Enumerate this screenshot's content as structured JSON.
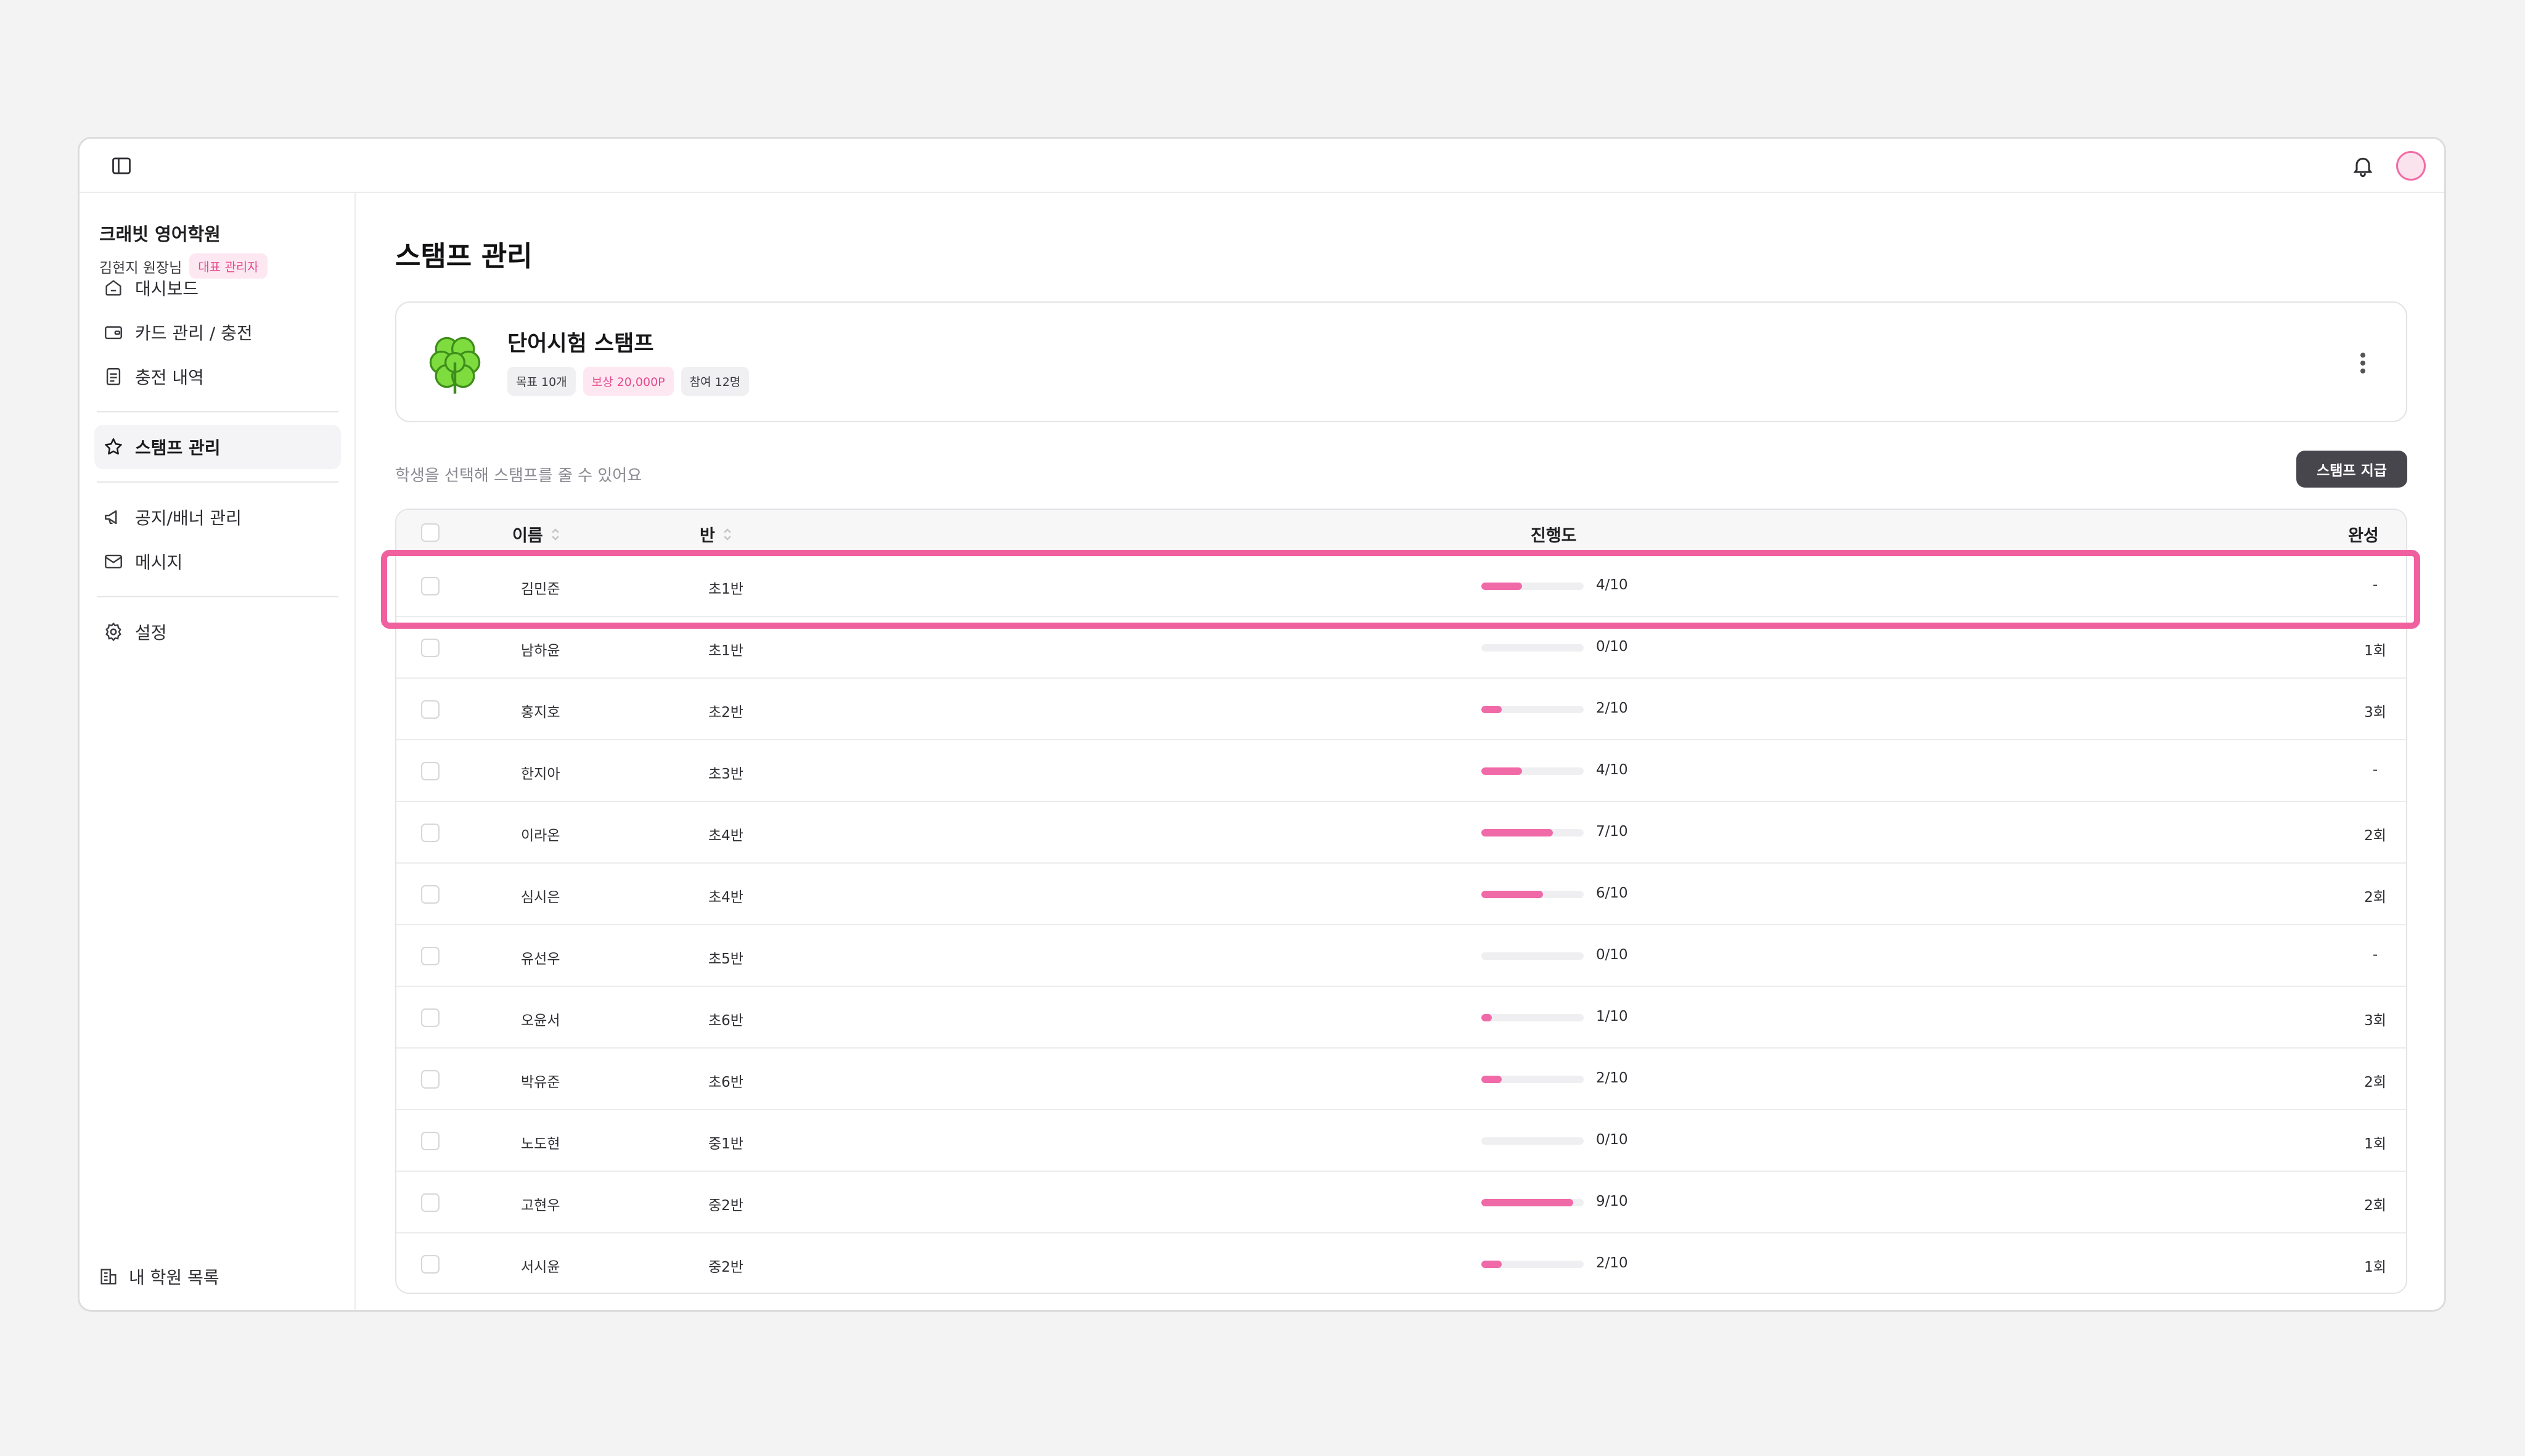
{
  "academy": {
    "name": "크래빗 영어학원",
    "owner": "김현지 원장님",
    "role": "대표 관리자"
  },
  "nav": {
    "group1": [
      {
        "label": "대시보드",
        "icon": "home-icon"
      },
      {
        "label": "카드 관리 / 충전",
        "icon": "wallet-icon"
      },
      {
        "label": "충전 내역",
        "icon": "receipt-icon"
      }
    ],
    "group2": [
      {
        "label": "스탬프 관리",
        "icon": "star-icon",
        "active": true
      }
    ],
    "group3": [
      {
        "label": "공지/배너 관리",
        "icon": "megaphone-icon"
      },
      {
        "label": "메시지",
        "icon": "mail-icon"
      }
    ],
    "group4": [
      {
        "label": "설정",
        "icon": "gear-icon"
      }
    ],
    "footer": "내 학원 목록"
  },
  "page": {
    "title": "스탬프 관리"
  },
  "stamp": {
    "title": "단어시험 스탬프",
    "chips": {
      "goal": "목표 10개",
      "reward": "보상 20,000P",
      "participants": "참여 12명"
    }
  },
  "helper_text": "학생을 선택해 스탬프를 줄 수 있어요",
  "grant_button": "스탬프 지급",
  "table": {
    "headers": {
      "name": "이름",
      "class": "반",
      "progress": "진행도",
      "done": "완성"
    },
    "rows": [
      {
        "name": "김민준",
        "class": "초1반",
        "progress": "4/10",
        "value": 0.4,
        "done": "-"
      },
      {
        "name": "남하윤",
        "class": "초1반",
        "progress": "0/10",
        "value": 0.0,
        "done": "1회"
      },
      {
        "name": "홍지호",
        "class": "초2반",
        "progress": "2/10",
        "value": 0.2,
        "done": "3회"
      },
      {
        "name": "한지아",
        "class": "초3반",
        "progress": "4/10",
        "value": 0.4,
        "done": "-"
      },
      {
        "name": "이라온",
        "class": "초4반",
        "progress": "7/10",
        "value": 0.7,
        "done": "2회"
      },
      {
        "name": "심시은",
        "class": "초4반",
        "progress": "6/10",
        "value": 0.6,
        "done": "2회"
      },
      {
        "name": "유선우",
        "class": "초5반",
        "progress": "0/10",
        "value": 0.0,
        "done": "-"
      },
      {
        "name": "오윤서",
        "class": "초6반",
        "progress": "1/10",
        "value": 0.1,
        "done": "3회"
      },
      {
        "name": "박유준",
        "class": "초6반",
        "progress": "2/10",
        "value": 0.2,
        "done": "2회"
      },
      {
        "name": "노도현",
        "class": "중1반",
        "progress": "0/10",
        "value": 0.0,
        "done": "1회"
      },
      {
        "name": "고현우",
        "class": "중2반",
        "progress": "9/10",
        "value": 0.9,
        "done": "2회"
      },
      {
        "name": "서시윤",
        "class": "중2반",
        "progress": "2/10",
        "value": 0.2,
        "done": "1회"
      }
    ]
  },
  "colors": {
    "accent": "#f06aa8",
    "highlight": "#f0609f",
    "button": "#46464c"
  }
}
